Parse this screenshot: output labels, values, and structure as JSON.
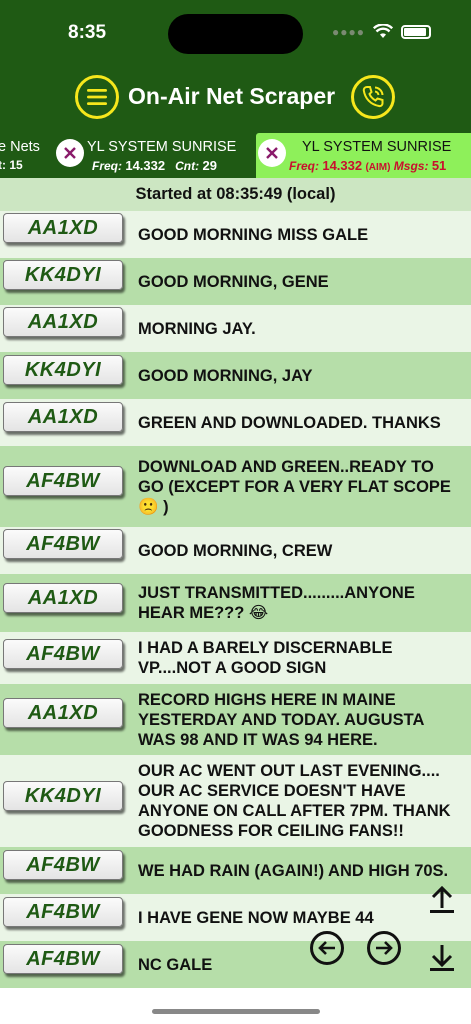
{
  "status_bar": {
    "time": "8:35"
  },
  "app": {
    "title": "On-Air Net Scraper"
  },
  "icons": {
    "menu": "hamburger-menu-icon",
    "phone": "phone-call-icon",
    "close": "close-x-icon"
  },
  "colors": {
    "header_bg": "#1f5a14",
    "accent_yellow": "#f6e71c",
    "active_tab": "#8ef05a",
    "row_light": "#eaf5e6",
    "row_dark": "#b6dea9",
    "callsign_text": "#1f5a14",
    "freq_red": "#c8102e"
  },
  "tabs": [
    {
      "name": "e Nets",
      "meta": "t: 15"
    },
    {
      "name": "YL SYSTEM SUNRISE",
      "freq_label": "Freq:",
      "freq": "14.332",
      "count_label": "Cnt:",
      "count": "29"
    },
    {
      "name": "YL SYSTEM SUNRISE",
      "freq_label": "Freq:",
      "freq": "14.332",
      "mode": "(AIM)",
      "msgs_label": "Msgs:",
      "msgs": "51",
      "active": true
    }
  ],
  "started": "Started at 08:35:49 (local)",
  "messages": [
    {
      "call": "AA1XD",
      "text": "GOOD MORNING MISS GALE"
    },
    {
      "call": "KK4DYI",
      "text": "GOOD MORNING, GENE"
    },
    {
      "call": "AA1XD",
      "text": "MORNING JAY."
    },
    {
      "call": "KK4DYI",
      "text": "GOOD MORNING, JAY"
    },
    {
      "call": "AA1XD",
      "text": "GREEN AND DOWNLOADED.  THANKS"
    },
    {
      "call": "AF4BW",
      "text": "DOWNLOAD AND GREEN..READY TO GO (EXCEPT FOR A VERY FLAT SCOPE 🙁 )"
    },
    {
      "call": "AF4BW",
      "text": "GOOD MORNING, CREW"
    },
    {
      "call": "AA1XD",
      "text": "JUST TRANSMITTED.........ANYONE HEAR ME???  😂"
    },
    {
      "call": "AF4BW",
      "text": "I HAD A BARELY DISCERNABLE VP....NOT A GOOD SIGN"
    },
    {
      "call": "AA1XD",
      "text": "RECORD HIGHS HERE IN MAINE YESTERDAY AND TODAY.  AUGUSTA WAS 98 AND IT WAS 94 HERE."
    },
    {
      "call": "KK4DYI",
      "text": "OUR AC WENT OUT LAST EVENING.... OUR AC SERVICE DOESN'T HAVE ANYONE ON CALL AFTER 7PM.  THANK GOODNESS FOR CEILING FANS!!"
    },
    {
      "call": "AF4BW",
      "text": "WE HAD RAIN (AGAIN!) AND HIGH 70S."
    },
    {
      "call": "AF4BW",
      "text": "I HAVE GENE NOW MAYBE 44"
    },
    {
      "call": "AF4BW",
      "text": "NC GALE"
    }
  ]
}
